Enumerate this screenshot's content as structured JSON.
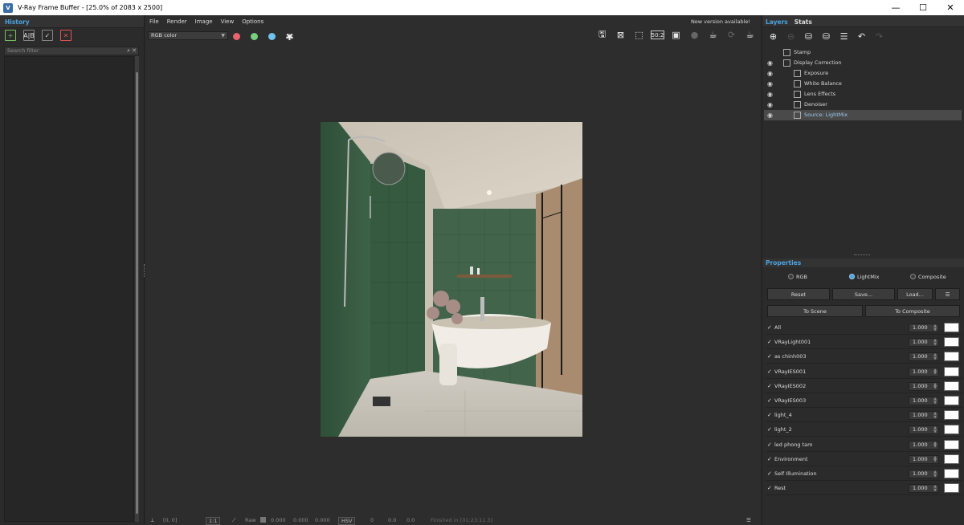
{
  "window": {
    "title": "V-Ray Frame Buffer - [25.0% of 2083 x 2500]",
    "controls": [
      "—",
      "☐",
      "✕"
    ]
  },
  "history": {
    "header": "History",
    "search_placeholder": "Search filter"
  },
  "menu": {
    "items": [
      "File",
      "Render",
      "Image",
      "View",
      "Options"
    ],
    "notice": "New version available!"
  },
  "toolbar": {
    "channel": "RGB color",
    "zoom_badge": "50:2"
  },
  "statusbar": {
    "coords": "[0, 0]",
    "ratio": "1:1",
    "raw_label": "Raw",
    "rgb": [
      "0.000",
      "0.000",
      "0.000"
    ],
    "space": "HSV",
    "hsv": [
      "0",
      "0.0",
      "0.0"
    ],
    "finished": "Finished in [01:23:11.3]"
  },
  "right_panel": {
    "tabs": [
      "Layers",
      "Stats"
    ],
    "layers": [
      {
        "name": "Stamp",
        "visible": false,
        "indent": 0,
        "selected": false
      },
      {
        "name": "Display Correction",
        "visible": true,
        "indent": 0,
        "selected": false
      },
      {
        "name": "Exposure",
        "visible": true,
        "indent": 1,
        "selected": false
      },
      {
        "name": "White Balance",
        "visible": true,
        "indent": 1,
        "selected": false
      },
      {
        "name": "Lens Effects",
        "visible": true,
        "indent": 1,
        "selected": false
      },
      {
        "name": "Denoiser",
        "visible": true,
        "indent": 1,
        "selected": false
      },
      {
        "name": "Source: LightMix",
        "visible": true,
        "indent": 1,
        "selected": true
      }
    ],
    "properties": {
      "header": "Properties",
      "modes": [
        "RGB",
        "LightMix",
        "Composite"
      ],
      "selected_mode": "LightMix",
      "buttons": {
        "reset": "Reset",
        "save": "Save...",
        "load": "Load...",
        "to_scene": "To Scene",
        "to_composite": "To Composite"
      },
      "lights": [
        {
          "name": "All",
          "value": "1.000"
        },
        {
          "name": "VRayLight001",
          "value": "1.000"
        },
        {
          "name": "as chinh003",
          "value": "1.000"
        },
        {
          "name": "VRayIES001",
          "value": "1.000"
        },
        {
          "name": "VRayIES002",
          "value": "1.000"
        },
        {
          "name": "VRayIES003",
          "value": "1.000"
        },
        {
          "name": "light_4",
          "value": "1.000"
        },
        {
          "name": "light_2",
          "value": "1.000"
        },
        {
          "name": "led phong tam",
          "value": "1.000"
        },
        {
          "name": "Environment",
          "value": "1.000"
        },
        {
          "name": "Self Illumination",
          "value": "1.000"
        },
        {
          "name": "Rest",
          "value": "1.000"
        }
      ]
    }
  },
  "colors": {
    "accent": "#4aa3df",
    "red_dot": "#e8636b",
    "green_dot": "#78d07c",
    "blue_dot": "#6fc3ee"
  }
}
